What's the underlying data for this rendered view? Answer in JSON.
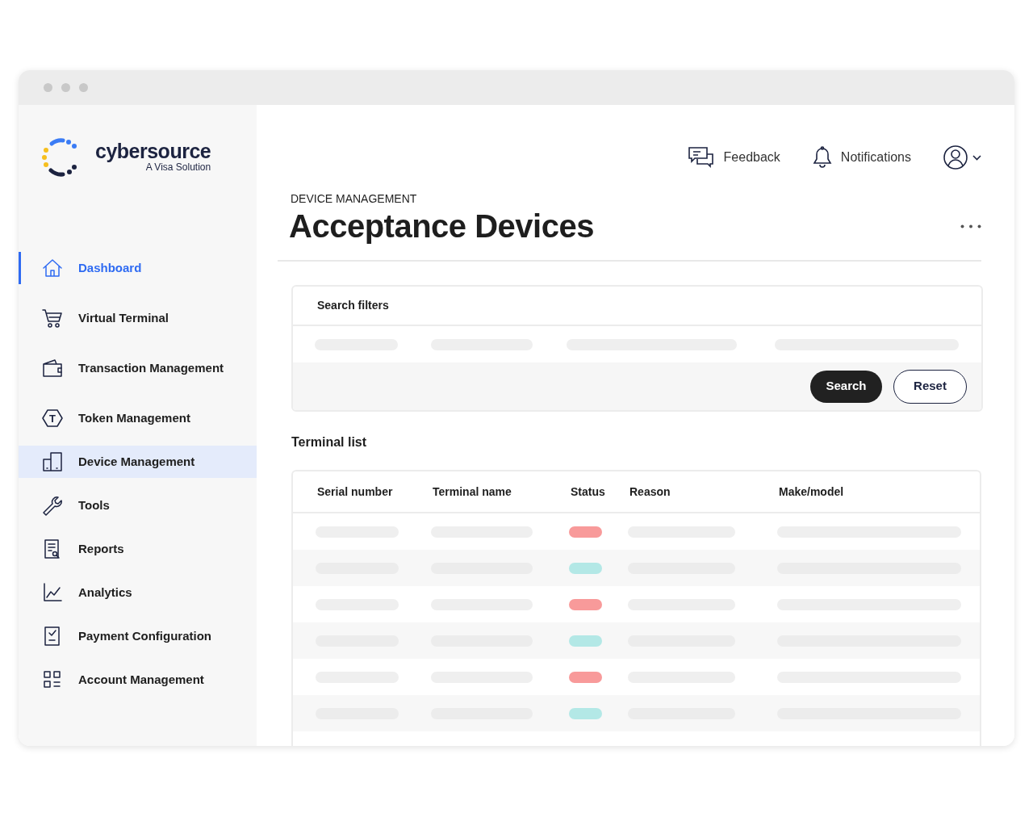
{
  "logo": {
    "name": "cybersource",
    "tagline": "A Visa Solution"
  },
  "sidebar": {
    "items": [
      {
        "label": "Dashboard",
        "active": true,
        "selected": false
      },
      {
        "label": "Virtual Terminal",
        "active": false,
        "selected": false
      },
      {
        "label": "Transaction Management",
        "active": false,
        "selected": false
      },
      {
        "label": "Token Management",
        "icon_text": "T",
        "active": false,
        "selected": false
      },
      {
        "label": "Device Management",
        "active": false,
        "selected": true
      },
      {
        "label": "Tools",
        "active": false,
        "selected": false
      },
      {
        "label": "Reports",
        "active": false,
        "selected": false
      },
      {
        "label": "Analytics",
        "active": false,
        "selected": false
      },
      {
        "label": "Payment Configuration",
        "active": false,
        "selected": false
      },
      {
        "label": "Account Management",
        "active": false,
        "selected": false
      }
    ]
  },
  "header": {
    "feedback": "Feedback",
    "notifications": "Notifications"
  },
  "page": {
    "breadcrumb": "DEVICE MANAGEMENT",
    "title": "Acceptance Devices"
  },
  "filters": {
    "title": "Search filters",
    "buttons": [
      {
        "label": "Search",
        "kind": "primary"
      },
      {
        "label": "Reset",
        "kind": "secondary"
      }
    ]
  },
  "table": {
    "title": "Terminal list",
    "columns": [
      "Serial number",
      "Terminal name",
      "Status",
      "Reason",
      "Make/model"
    ],
    "rows": [
      {
        "color": "#f89a9a"
      },
      {
        "color": "#b3e8e6"
      },
      {
        "color": "#f89a9a"
      },
      {
        "color": "#b3e8e6"
      },
      {
        "color": "#f89a9a"
      },
      {
        "color": "#b3e8e6"
      }
    ]
  }
}
